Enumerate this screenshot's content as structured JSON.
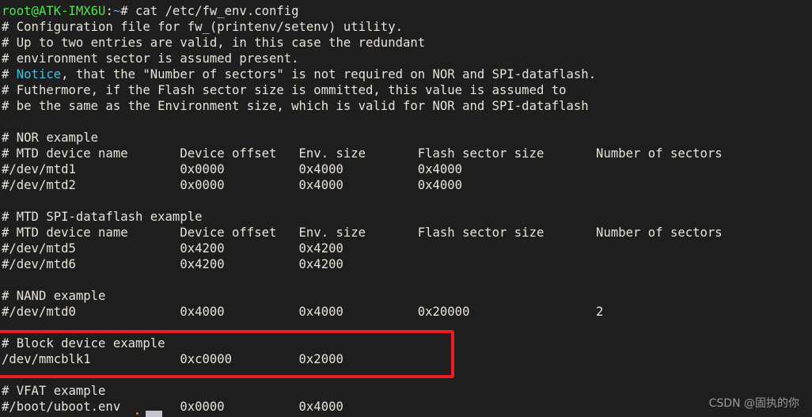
{
  "terminal": {
    "background_color": "#1e1e1e",
    "foreground_color": "#e8e3d8",
    "prompt": {
      "user_host": "root@ATK-IMX6U",
      "colon": ":",
      "path": "~",
      "hash_and_command": "# cat /etc/fw_env.config"
    },
    "lines": [
      "# Configuration file for fw_(printenv/setenv) utility.",
      "# Up to two entries are valid, in this case the redundant",
      "# environment sector is assumed present.",
      "# Notice, that the \"Number of sectors\" is not required on NOR and SPI-dataflash.",
      "# Futhermore, if the Flash sector size is ommitted, this value is assumed to",
      "# be the same as the Environment size, which is valid for NOR and SPI-dataflash",
      "",
      "# NOR example",
      "# MTD device name       Device offset   Env. size       Flash sector size       Number of sectors",
      "#/dev/mtd1              0x0000          0x4000          0x4000",
      "#/dev/mtd2              0x0000          0x4000          0x4000",
      "",
      "# MTD SPI-dataflash example",
      "# MTD device name       Device offset   Env. size       Flash sector size       Number of sectors",
      "#/dev/mtd5              0x4200          0x4200",
      "#/dev/mtd6              0x4200          0x4200",
      "",
      "# NAND example",
      "#/dev/mtd0              0x4000          0x4000          0x20000                 2",
      "",
      "# Block device example",
      "/dev/mmcblk1            0xc0000         0x2000",
      "",
      "# VFAT example",
      "#/boot/uboot.env        0x0000          0x4000"
    ],
    "notice_keyword": "Notice",
    "notice_color": "#3fc1e0"
  },
  "annotation": {
    "type": "rectangle-highlight",
    "color": "#ed1c24",
    "highlighted_lines": [
      "# Block device example",
      "/dev/mmcblk1            0xc0000         0x2000"
    ]
  },
  "watermark": {
    "text": "CSDN @固执的你",
    "color": "#9a9a9a"
  }
}
